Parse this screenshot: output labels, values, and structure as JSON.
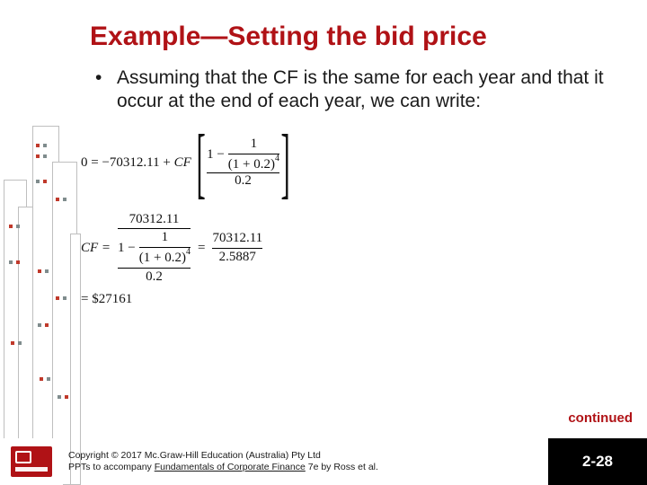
{
  "title": "Example—Setting the bid price",
  "bullet": {
    "marker": "•",
    "text": "Assuming that the CF is the same for each year and that it occur at the end of each year, we can write:"
  },
  "equations": {
    "npv_prefix": "0 = −70312.11 + ",
    "cf_symbol": "CF",
    "bracket_inner": {
      "one": "1",
      "one_minus": "1 −",
      "frac_top": "1",
      "rate_base": "(1 + 0.2)",
      "rate_exp": "4",
      "denom": "0.2"
    },
    "cf_line": {
      "cf_eq": "CF =",
      "num": "70312.11",
      "eq": "=",
      "rhs_num": "70312.11",
      "rhs_den": "2.5887"
    },
    "result": "= $27161"
  },
  "continued": "continued",
  "footer": {
    "copyright": "Copyright © 2017 Mc.Graw-Hill Education (Australia) Pty Ltd",
    "line2_prefix": "PPTs to accompany ",
    "line2_title": "Fundamentals of Corporate Finance",
    "line2_suffix": " 7e by Ross et al.",
    "page": "2-28",
    "logo_alt": "McGraw-Hill Education"
  }
}
